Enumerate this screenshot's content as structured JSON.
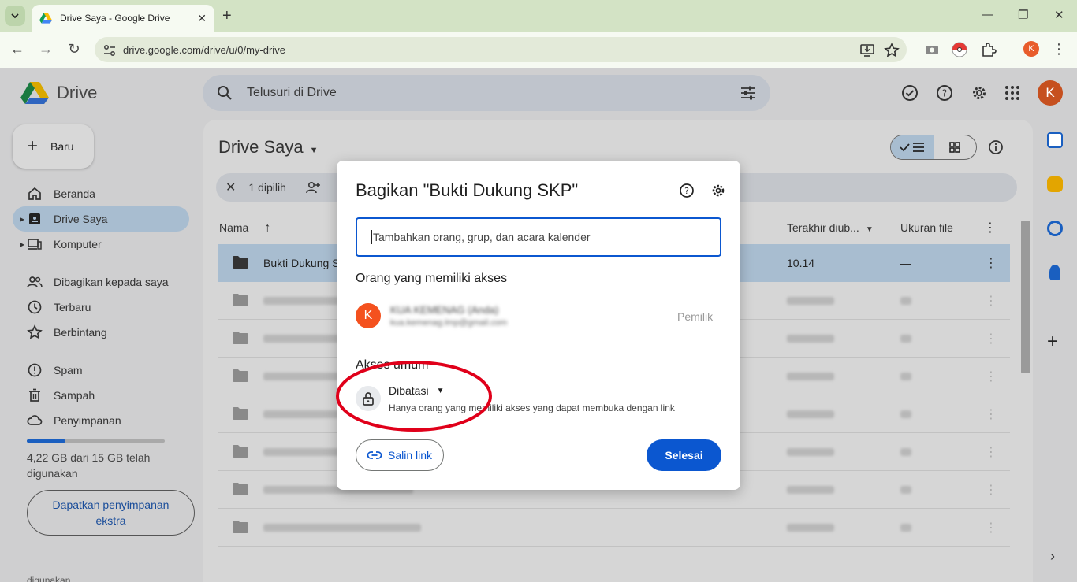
{
  "browser": {
    "tab_title": "Drive Saya - Google Drive",
    "url": "drive.google.com/drive/u/0/my-drive",
    "profile_initial": "K",
    "accent": "#d3e3c5"
  },
  "drive": {
    "app_name": "Drive",
    "search_placeholder": "Telusuri di Drive",
    "avatar_initial": "K",
    "new_button": "Baru",
    "sidebar": [
      {
        "label": "Beranda",
        "icon": "home-icon"
      },
      {
        "label": "Drive Saya",
        "icon": "my-drive-icon",
        "active": true
      },
      {
        "label": "Komputer",
        "icon": "computer-icon"
      },
      {
        "label": "Dibagikan kepada saya",
        "icon": "shared-icon"
      },
      {
        "label": "Terbaru",
        "icon": "clock-icon"
      },
      {
        "label": "Berbintang",
        "icon": "star-icon"
      },
      {
        "label": "Spam",
        "icon": "spam-icon"
      },
      {
        "label": "Sampah",
        "icon": "trash-icon"
      },
      {
        "label": "Penyimpanan",
        "icon": "cloud-icon"
      }
    ],
    "storage": {
      "text": "4,22 GB dari 15 GB telah digunakan",
      "used_fraction": 0.28,
      "get_more": "Dapatkan penyimpanan ekstra",
      "cutoff": "digunakan"
    },
    "main": {
      "title": "Drive Saya",
      "selection_count": "1 dipilih",
      "columns": {
        "name": "Nama",
        "modified": "Terakhir diub...",
        "size": "Ukuran file"
      },
      "rows": [
        {
          "name": "Bukti Dukung S",
          "date": "10.14",
          "size": "—",
          "selected": true
        },
        {
          "name": "",
          "date": "",
          "size": ""
        },
        {
          "name": "",
          "date": "",
          "size": ""
        },
        {
          "name": "",
          "date": "",
          "size": ""
        },
        {
          "name": "",
          "date": "",
          "size": ""
        },
        {
          "name": "",
          "date": "",
          "size": ""
        },
        {
          "name": "",
          "date": "",
          "size": ""
        },
        {
          "name": "",
          "date": "",
          "size": ""
        }
      ]
    }
  },
  "dialog": {
    "title": "Bagikan \"Bukti Dukung SKP\"",
    "input_placeholder": "Tambahkan orang, grup, dan acara kalender",
    "people_heading": "Orang yang memiliki akses",
    "person": {
      "initial": "K",
      "name": "KUA KEMENAG (Anda)",
      "email": "kua.kemenag.lmp@gmail.com",
      "role": "Pemilik"
    },
    "general_access_heading": "Akses umum",
    "access_value": "Dibatasi",
    "access_desc": "Hanya orang yang memiliki akses yang dapat membuka dengan link",
    "copy_link": "Salin link",
    "done": "Selesai",
    "primary_color": "#0b57d0",
    "annotation_color": "#e0001a"
  }
}
